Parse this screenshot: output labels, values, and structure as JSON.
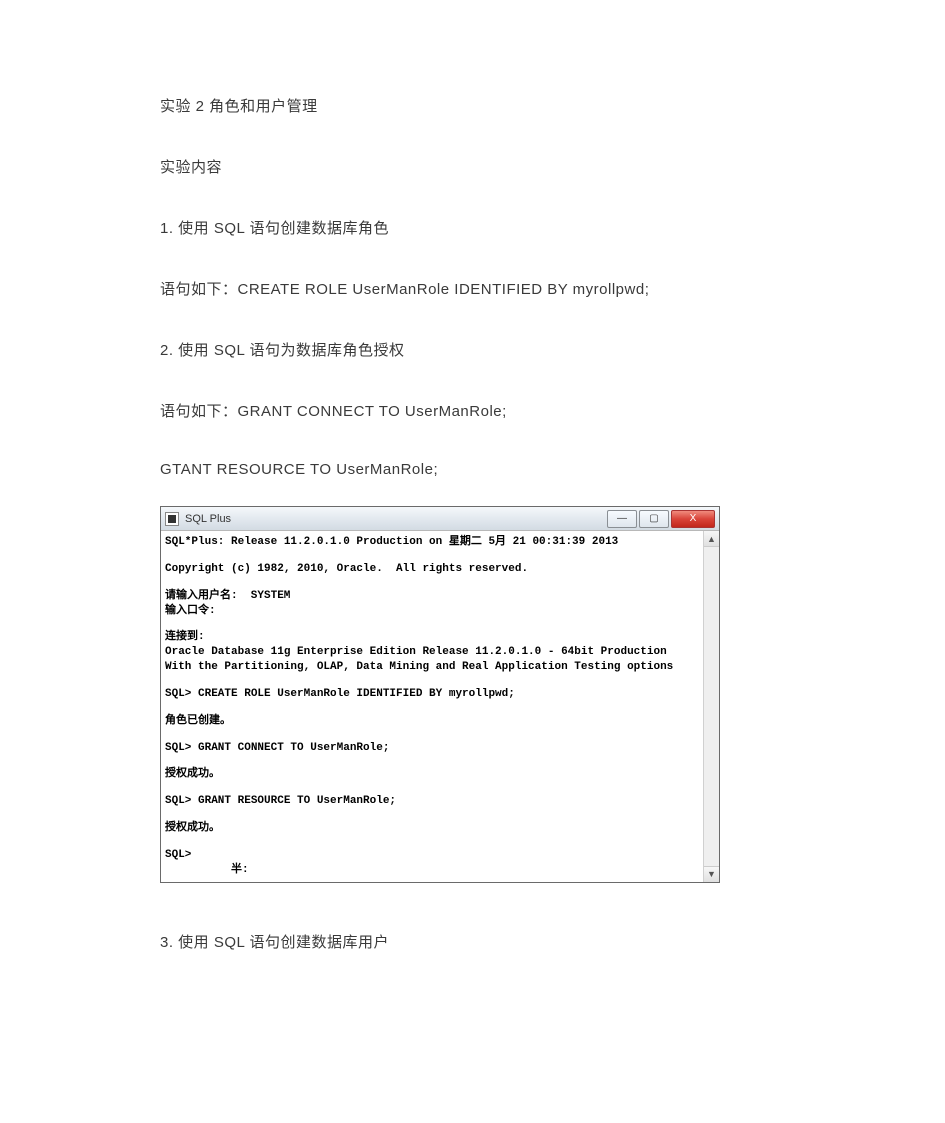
{
  "doc": {
    "title": "实验 2    角色和用户管理",
    "section_content": "实验内容",
    "h1": "1. 使用 SQL 语句创建数据库角色",
    "p1": "语句如下：CREATE ROLE UserManRole IDENTIFIED BY myrollpwd;",
    "h2": "2. 使用 SQL 语句为数据库角色授权",
    "p2": "语句如下：GRANT CONNECT TO UserManRole;",
    "p3": "GTANT RESOURCE TO UserManRole;",
    "h3": "3. 使用 SQL 语句创建数据库用户"
  },
  "window": {
    "title": "SQL Plus",
    "min_glyph": "—",
    "max_glyph": "▢",
    "close_glyph": "X"
  },
  "term": {
    "l1": "SQL*Plus: Release 11.2.0.1.0 Production on 星期二 5月 21 00:31:39 2013",
    "l2": "Copyright (c) 1982, 2010, Oracle.  All rights reserved.",
    "l3": "请输入用户名:  SYSTEM",
    "l4": "输入口令:",
    "l5": "连接到:",
    "l6": "Oracle Database 11g Enterprise Edition Release 11.2.0.1.0 - 64bit Production",
    "l7": "With the Partitioning, OLAP, Data Mining and Real Application Testing options",
    "l8": "SQL> CREATE ROLE UserManRole IDENTIFIED BY myrollpwd;",
    "l9": "角色已创建。",
    "l10": "SQL> GRANT CONNECT TO UserManRole;",
    "l11": "授权成功。",
    "l12": "SQL> GRANT RESOURCE TO UserManRole;",
    "l13": "授权成功。",
    "l14": "SQL>",
    "l15": "          半:"
  }
}
